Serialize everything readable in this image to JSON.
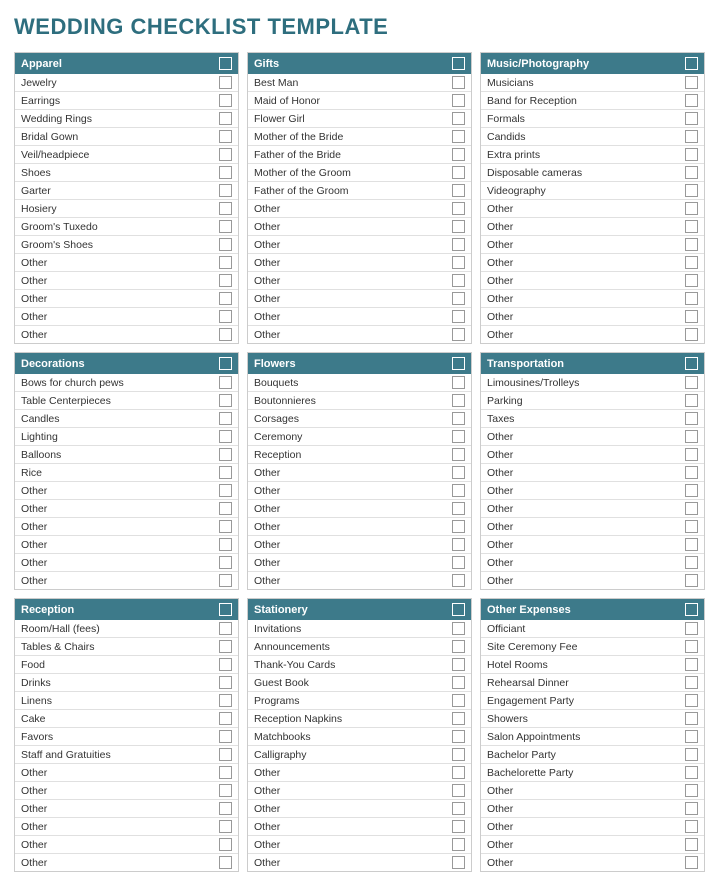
{
  "title": "WEDDING CHECKLIST TEMPLATE",
  "sections": [
    {
      "id": "apparel",
      "header": "Apparel",
      "items": [
        "Jewelry",
        "Earrings",
        "Wedding Rings",
        "Bridal Gown",
        "Veil/headpiece",
        "Shoes",
        "Garter",
        "Hosiery",
        "Groom's Tuxedo",
        "Groom's Shoes",
        "Other",
        "Other",
        "Other",
        "Other",
        "Other"
      ]
    },
    {
      "id": "gifts",
      "header": "Gifts",
      "items": [
        "Best Man",
        "Maid of Honor",
        "Flower Girl",
        "Mother of the Bride",
        "Father of the Bride",
        "Mother of the Groom",
        "Father of the Groom",
        "Other",
        "Other",
        "Other",
        "Other",
        "Other",
        "Other",
        "Other",
        "Other"
      ]
    },
    {
      "id": "music-photography",
      "header": "Music/Photography",
      "items": [
        "Musicians",
        "Band for Reception",
        "Formals",
        "Candids",
        "Extra prints",
        "Disposable cameras",
        "Videography",
        "Other",
        "Other",
        "Other",
        "Other",
        "Other",
        "Other",
        "Other",
        "Other"
      ]
    },
    {
      "id": "decorations",
      "header": "Decorations",
      "items": [
        "Bows for church pews",
        "Table Centerpieces",
        "Candles",
        "Lighting",
        "Balloons",
        "Rice",
        "Other",
        "Other",
        "Other",
        "Other",
        "Other",
        "Other"
      ]
    },
    {
      "id": "flowers",
      "header": "Flowers",
      "items": [
        "Bouquets",
        "Boutonnieres",
        "Corsages",
        "Ceremony",
        "Reception",
        "Other",
        "Other",
        "Other",
        "Other",
        "Other",
        "Other",
        "Other"
      ]
    },
    {
      "id": "transportation",
      "header": "Transportation",
      "items": [
        "Limousines/Trolleys",
        "Parking",
        "Taxes",
        "Other",
        "Other",
        "Other",
        "Other",
        "Other",
        "Other",
        "Other",
        "Other",
        "Other"
      ]
    },
    {
      "id": "reception",
      "header": "Reception",
      "items": [
        "Room/Hall (fees)",
        "Tables & Chairs",
        "Food",
        "Drinks",
        "Linens",
        "Cake",
        "Favors",
        "Staff and Gratuities",
        "Other",
        "Other",
        "Other",
        "Other",
        "Other",
        "Other"
      ]
    },
    {
      "id": "stationery",
      "header": "Stationery",
      "items": [
        "Invitations",
        "Announcements",
        "Thank-You Cards",
        "Guest Book",
        "Programs",
        "Reception Napkins",
        "Matchbooks",
        "Calligraphy",
        "Other",
        "Other",
        "Other",
        "Other",
        "Other",
        "Other"
      ]
    },
    {
      "id": "other-expenses",
      "header": "Other Expenses",
      "items": [
        "Officiant",
        "Site Ceremony Fee",
        "Hotel Rooms",
        "Rehearsal Dinner",
        "Engagement Party",
        "Showers",
        "Salon Appointments",
        "Bachelor Party",
        "Bachelorette Party",
        "Other",
        "Other",
        "Other",
        "Other",
        "Other"
      ]
    }
  ]
}
